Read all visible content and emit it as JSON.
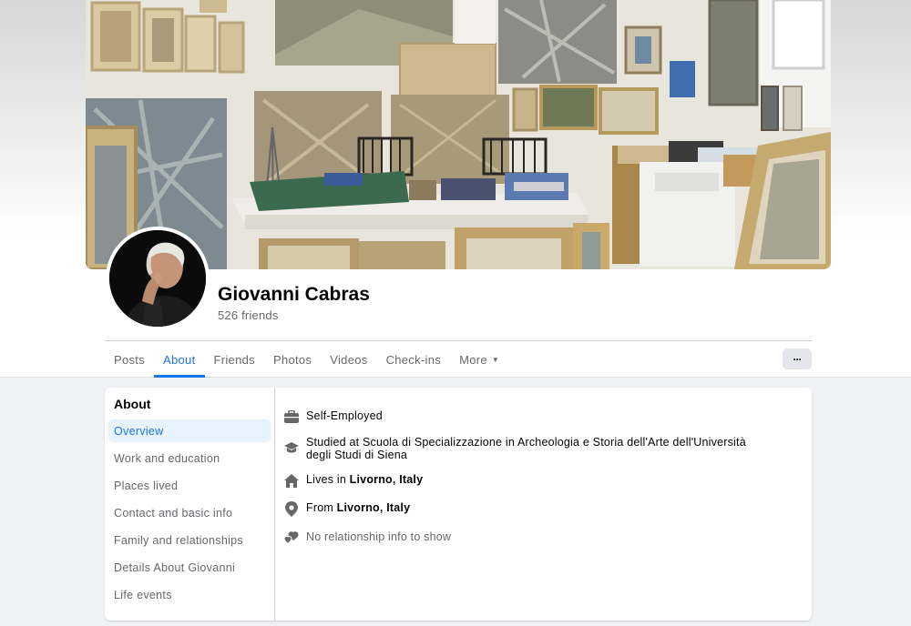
{
  "profile": {
    "name": "Giovanni Cabras",
    "friends": "526 friends"
  },
  "tabs": [
    {
      "label": "Posts",
      "active": false
    },
    {
      "label": "About",
      "active": true
    },
    {
      "label": "Friends",
      "active": false
    },
    {
      "label": "Photos",
      "active": false
    },
    {
      "label": "Videos",
      "active": false
    },
    {
      "label": "Check-ins",
      "active": false
    },
    {
      "label": "More",
      "active": false
    }
  ],
  "more_button_label": "···",
  "about": {
    "title": "About",
    "sidebar": [
      {
        "label": "Overview",
        "active": true
      },
      {
        "label": "Work and education",
        "active": false
      },
      {
        "label": "Places lived",
        "active": false
      },
      {
        "label": "Contact and basic info",
        "active": false
      },
      {
        "label": "Family and relationships",
        "active": false
      },
      {
        "label": "Details About Giovanni",
        "active": false
      },
      {
        "label": "Life events",
        "active": false
      }
    ],
    "details": {
      "work": {
        "icon": "briefcase-icon",
        "text": "Self-Employed"
      },
      "education": {
        "icon": "graduation-cap-icon",
        "line1": "Studied at Scuola di Specializzazione in Archeologia e Storia dell'Arte dell'Università",
        "line2": "degli Studi di Siena"
      },
      "lives": {
        "icon": "house-icon",
        "prefix": "Lives in ",
        "place": "Livorno, Italy"
      },
      "from": {
        "icon": "location-pin-icon",
        "prefix": "From ",
        "place": "Livorno, Italy"
      },
      "relationship": {
        "icon": "hearts-icon",
        "text": "No relationship info to show"
      }
    }
  },
  "colors": {
    "accent": "#1b74e4",
    "secondary_text": "#65676b",
    "page_background": "#f0f2f5",
    "card_background": "#ffffff"
  }
}
